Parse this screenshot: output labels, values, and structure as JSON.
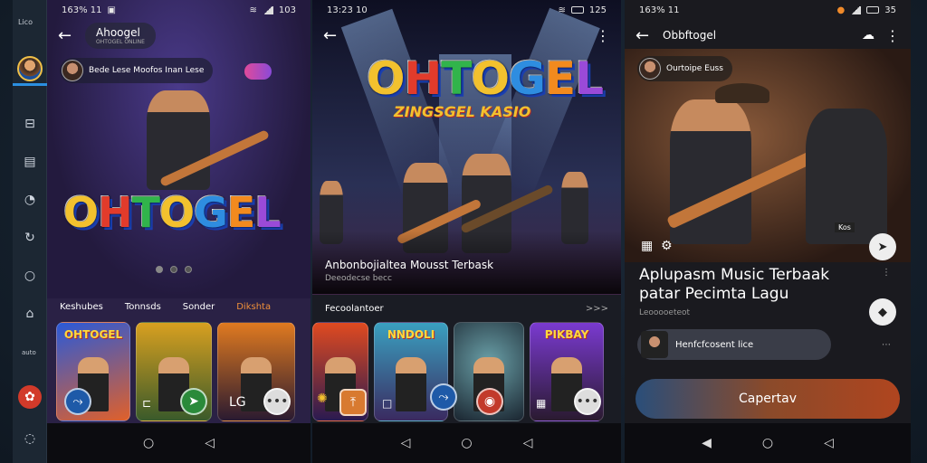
{
  "rail": {
    "top_text": "Lico",
    "mid_text": "auto",
    "icons": [
      "message-icon",
      "document-icon",
      "chat-bubble-icon",
      "refresh-icon",
      "comment-icon",
      "home-icon",
      "settings-red-icon",
      "chat-small-icon"
    ]
  },
  "phone1": {
    "status_time": "163% 11",
    "status_right": "103",
    "title": "Ahoogel",
    "subtitle": "OHTOGEL ONLINE",
    "profile_text": "Bede Lese Moofos Inan Lese",
    "logo": [
      "O",
      "H",
      "T",
      "O",
      "G",
      "E",
      "L"
    ],
    "tabs": [
      "Keshubes",
      "Tonnsds",
      "Sonder",
      "Dikshta"
    ],
    "card1_title": "OHTOGEL",
    "card3_label": "LG"
  },
  "phone2": {
    "status_time": "13:23 10",
    "status_right": "125",
    "logo": [
      "O",
      "H",
      "T",
      "O",
      "G",
      "E",
      "L"
    ],
    "logo_sub": "ZINGSGEL KASIO",
    "caption_title": "Anbonbojialtea Mousst Terbask",
    "caption_sub": "Deeodecse becc",
    "section_title": "Fecoolantoer",
    "more": ">>>",
    "card2_title": "NNDOLI",
    "card4_title": "PIKBAY"
  },
  "phone3": {
    "status_time": "163% 11",
    "status_right": "35",
    "title": "Obbftogel",
    "profile_text": "Ourtoipe Euss",
    "headline_line1": "Aplupasm Music Terbaak",
    "headline_line2": "patar Pecimta Lagu",
    "sub": "Leooooeteot",
    "chip_text": "Henfcfcosent lice",
    "cta": "Capertav",
    "badge_text": "Kos"
  }
}
